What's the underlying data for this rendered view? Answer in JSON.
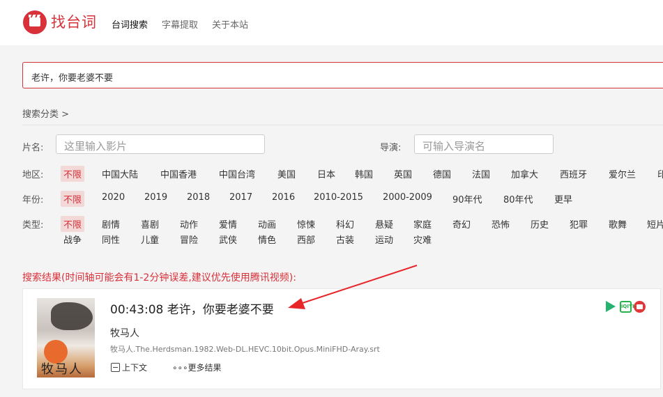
{
  "header": {
    "logo_text": "找台词",
    "nav": [
      "台词搜索",
      "字幕提取",
      "关于本站"
    ]
  },
  "search": {
    "query": "老许，你要老婆不要"
  },
  "category": {
    "breadcrumb": "搜索分类 >"
  },
  "filters": {
    "title_label": "片名:",
    "title_placeholder": "这里输入影片",
    "director_label": "导演:",
    "director_placeholder": "可输入导演名",
    "region_label": "地区:",
    "regions": [
      "不限",
      "中国大陆",
      "中国香港",
      "中国台湾",
      "美国",
      "日本",
      "韩国",
      "英国",
      "德国",
      "法国",
      "加拿大",
      "西班牙",
      "爱尔兰",
      "印"
    ],
    "year_label": "年份:",
    "years": [
      "不限",
      "2020",
      "2019",
      "2018",
      "2017",
      "2016",
      "2010-2015",
      "2000-2009",
      "90年代",
      "80年代",
      "更早"
    ],
    "genre_label": "类型:",
    "genres_row1": [
      "不限",
      "剧情",
      "喜剧",
      "动作",
      "爱情",
      "动画",
      "惊悚",
      "科幻",
      "悬疑",
      "家庭",
      "奇幻",
      "恐怖",
      "历史",
      "犯罪",
      "歌舞",
      "短片"
    ],
    "genres_row2": [
      "战争",
      "同性",
      "儿童",
      "冒险",
      "武侠",
      "情色",
      "西部",
      "古装",
      "运动",
      "灾难"
    ]
  },
  "results": {
    "heading": "搜索结果(时间轴可能会有1-2分钟误差,建议优先使用腾讯视频):",
    "items": [
      {
        "timestamp": "00:43:08",
        "line": "老许，你要老婆不要",
        "movie": "牧马人",
        "file": "牧马人.The.Herdsman.1982.Web-DL.HEVC.10bit.Opus.MiniFHD-Aray.srt",
        "poster_text": "牧马人",
        "context_label": "上下文",
        "more_label": "更多结果",
        "platform_icons": [
          "tencent-video-icon",
          "iqiyi-icon",
          "youku-icon"
        ],
        "iqiyi_badge": "iQIYI"
      }
    ]
  },
  "colors": {
    "accent": "#d8313a",
    "selected_bg": "#f3d8d8"
  }
}
